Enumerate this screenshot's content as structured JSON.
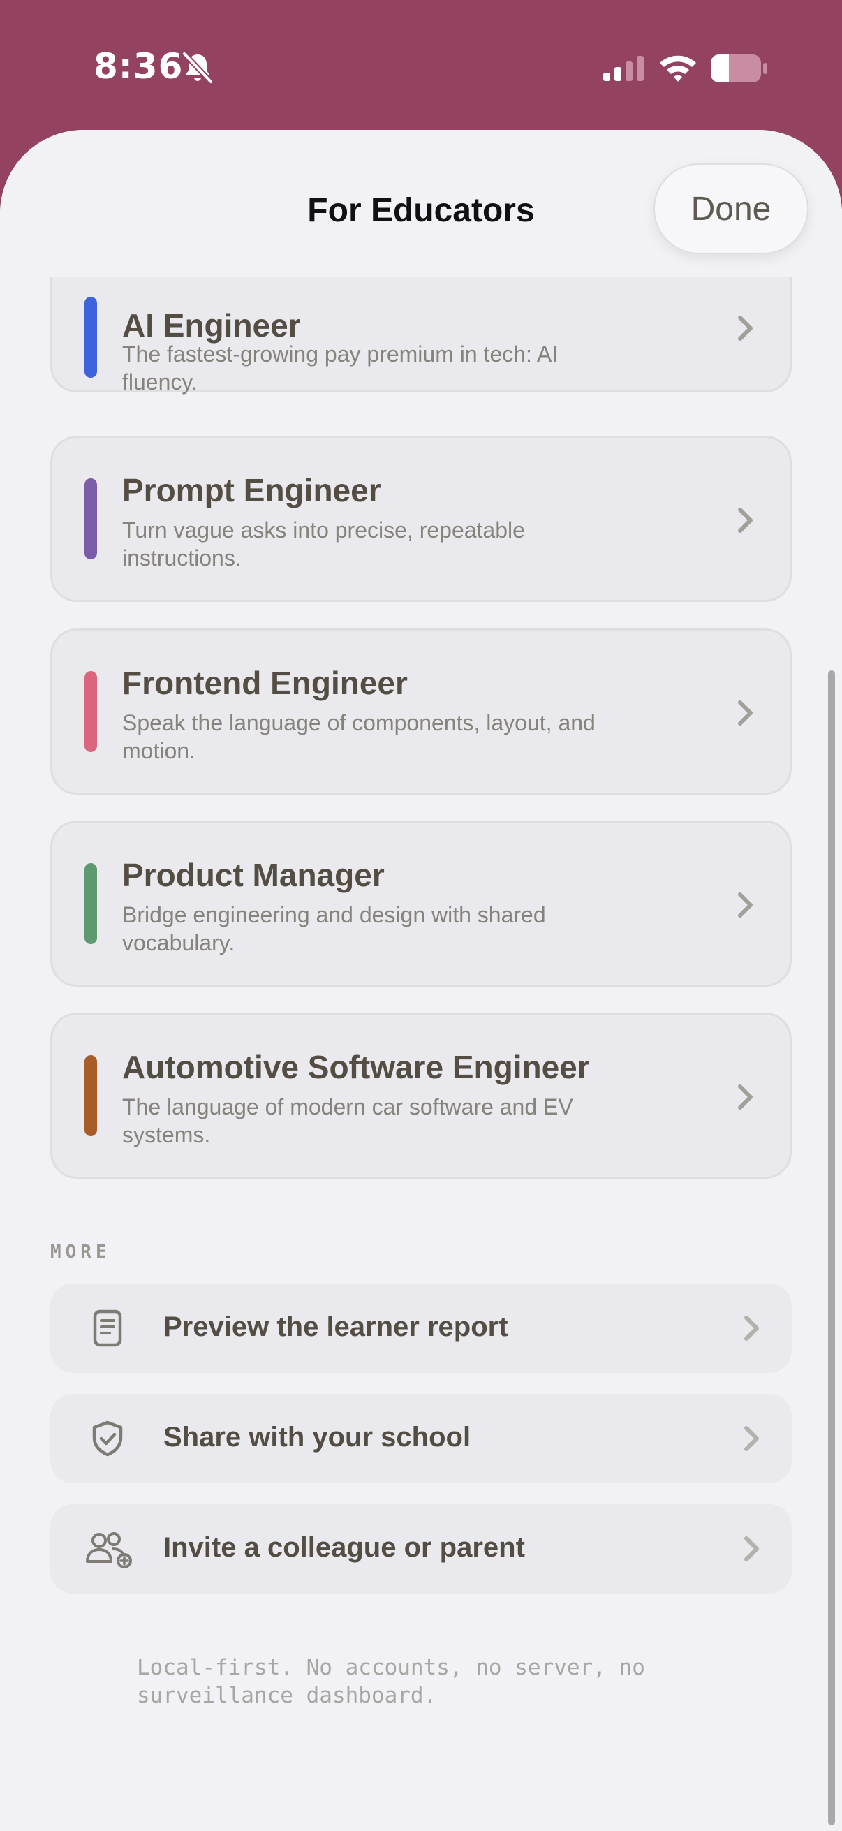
{
  "status_bar": {
    "time": "8:36"
  },
  "header": {
    "title": "For Educators",
    "done_label": "Done"
  },
  "roles": [
    {
      "title": "AI Engineer",
      "description": "The fastest-growing pay premium in tech: AI fluency.",
      "accent": "#3d63dd"
    },
    {
      "title": "Prompt Engineer",
      "description": "Turn vague asks into precise, repeatable instructions.",
      "accent": "#7b5ca8"
    },
    {
      "title": "Frontend Engineer",
      "description": "Speak the language of components, layout, and motion.",
      "accent": "#d9667c"
    },
    {
      "title": "Product Manager",
      "description": "Bridge engineering and design with shared vocabulary.",
      "accent": "#5e9a70"
    },
    {
      "title": "Automotive Software Engineer",
      "description": "The language of modern car software and EV systems.",
      "accent": "#a85c28"
    }
  ],
  "more": {
    "label": "MORE",
    "items": [
      {
        "label": "Preview the learner report",
        "icon": "document-icon"
      },
      {
        "label": "Share with your school",
        "icon": "shield-check-icon"
      },
      {
        "label": "Invite a colleague or parent",
        "icon": "people-add-icon"
      }
    ]
  },
  "footer": {
    "note": "Local-first. No accounts, no server, no surveillance dashboard."
  },
  "colors": {
    "background": "#934260",
    "sheet": "#f2f2f6",
    "card": "#eaeaee",
    "title_text": "#544d44"
  }
}
